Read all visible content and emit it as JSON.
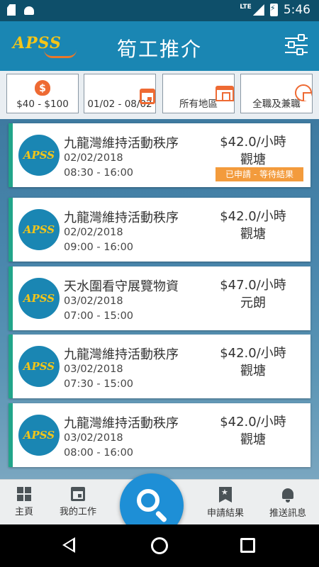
{
  "status_bar": {
    "network": "LTE",
    "time": "5:46"
  },
  "app_bar": {
    "logo_text": "APSS",
    "title": "筍工推介"
  },
  "filters": [
    {
      "label": "$40 - $100",
      "icon": "moneybag-icon"
    },
    {
      "label": "01/02 - 08/02",
      "icon": "calendar-icon"
    },
    {
      "label": "所有地區",
      "icon": "store-icon"
    },
    {
      "label": "全職及兼職",
      "icon": "pie-chart-icon"
    }
  ],
  "jobs": [
    {
      "logo": "APSS",
      "title": "九龍灣維持活動秩序",
      "date": "02/02/2018",
      "time": "08:30 - 16:00",
      "pay": "$42.0/小時",
      "area": "觀塘",
      "status": "已申請 - 等待結果"
    },
    {
      "logo": "APSS",
      "title": "九龍灣維持活動秩序",
      "date": "02/02/2018",
      "time": "09:00 - 16:00",
      "pay": "$42.0/小時",
      "area": "觀塘"
    },
    {
      "logo": "APSS",
      "title": "天水圍看守展覽物資",
      "date": "03/02/2018",
      "time": "07:00 - 15:00",
      "pay": "$47.0/小時",
      "area": "元朗"
    },
    {
      "logo": "APSS",
      "title": "九龍灣維持活動秩序",
      "date": "03/02/2018",
      "time": "07:30 - 15:00",
      "pay": "$42.0/小時",
      "area": "觀塘"
    },
    {
      "logo": "APSS",
      "title": "九龍灣維持活動秩序",
      "date": "03/02/2018",
      "time": "08:00 - 16:00",
      "pay": "$42.0/小時",
      "area": "觀塘"
    }
  ],
  "bottom_nav": {
    "home": "主頁",
    "my_jobs": "我的工作",
    "results": "申請結果",
    "notifications": "推送訊息"
  },
  "colors": {
    "primary": "#1a86b3",
    "accent": "#ee6a33",
    "badge": "#f39b3c",
    "card_stripe": "#21a58a",
    "fab": "#1e8fd6"
  }
}
